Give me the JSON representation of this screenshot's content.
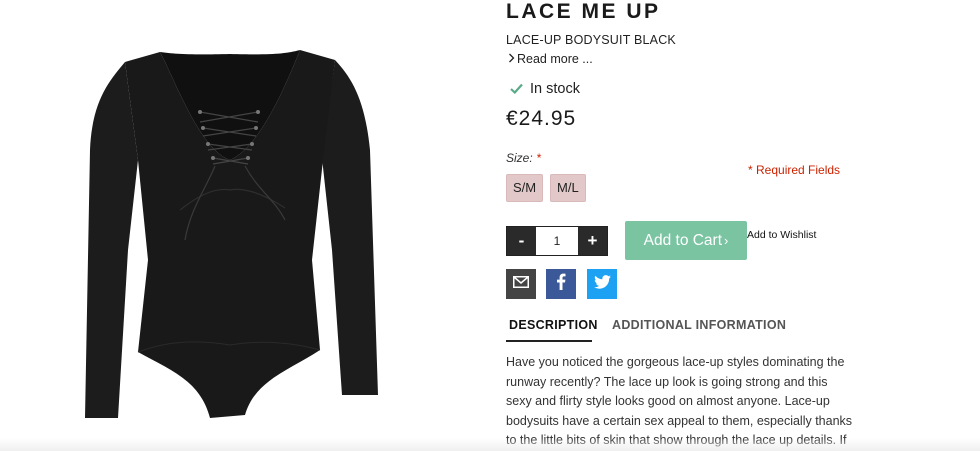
{
  "product": {
    "title": "LACE ME UP",
    "subtitle": "LACE-UP BODYSUIT BLACK",
    "read_more": "Read more ...",
    "stock": "In stock",
    "price": "€24.95"
  },
  "size": {
    "label": "Size:",
    "required_star": "*",
    "required_note": "* Required Fields",
    "options": [
      "S/M",
      "M/L"
    ]
  },
  "cart": {
    "minus": "-",
    "plus": "+",
    "quantity": "1",
    "add_to_cart": "Add to Cart",
    "add_to_cart_arrow": "›",
    "wishlist": "Add to Wishlist"
  },
  "share": {
    "icons": [
      "email-icon",
      "facebook-icon",
      "twitter-icon"
    ]
  },
  "tabs": {
    "description": "DESCRIPTION",
    "additional": "ADDITIONAL INFORMATION"
  },
  "description_text": "Have you noticed the gorgeous lace-up styles dominating the runway recently? The lace up look is going strong and this sexy and flirty style looks good on almost anyone. Lace-up bodysuits have a certain sex appeal to them, especially thanks to the little bits of skin that show through the lace up details. If you wear it just",
  "colors": {
    "add_to_cart_bg": "#7ac4a2",
    "size_option_bg": "#e2c8c8",
    "required": "#cc2200",
    "in_stock_check": "#5aaa8a",
    "facebook": "#3b5998",
    "twitter": "#1da1f2"
  }
}
